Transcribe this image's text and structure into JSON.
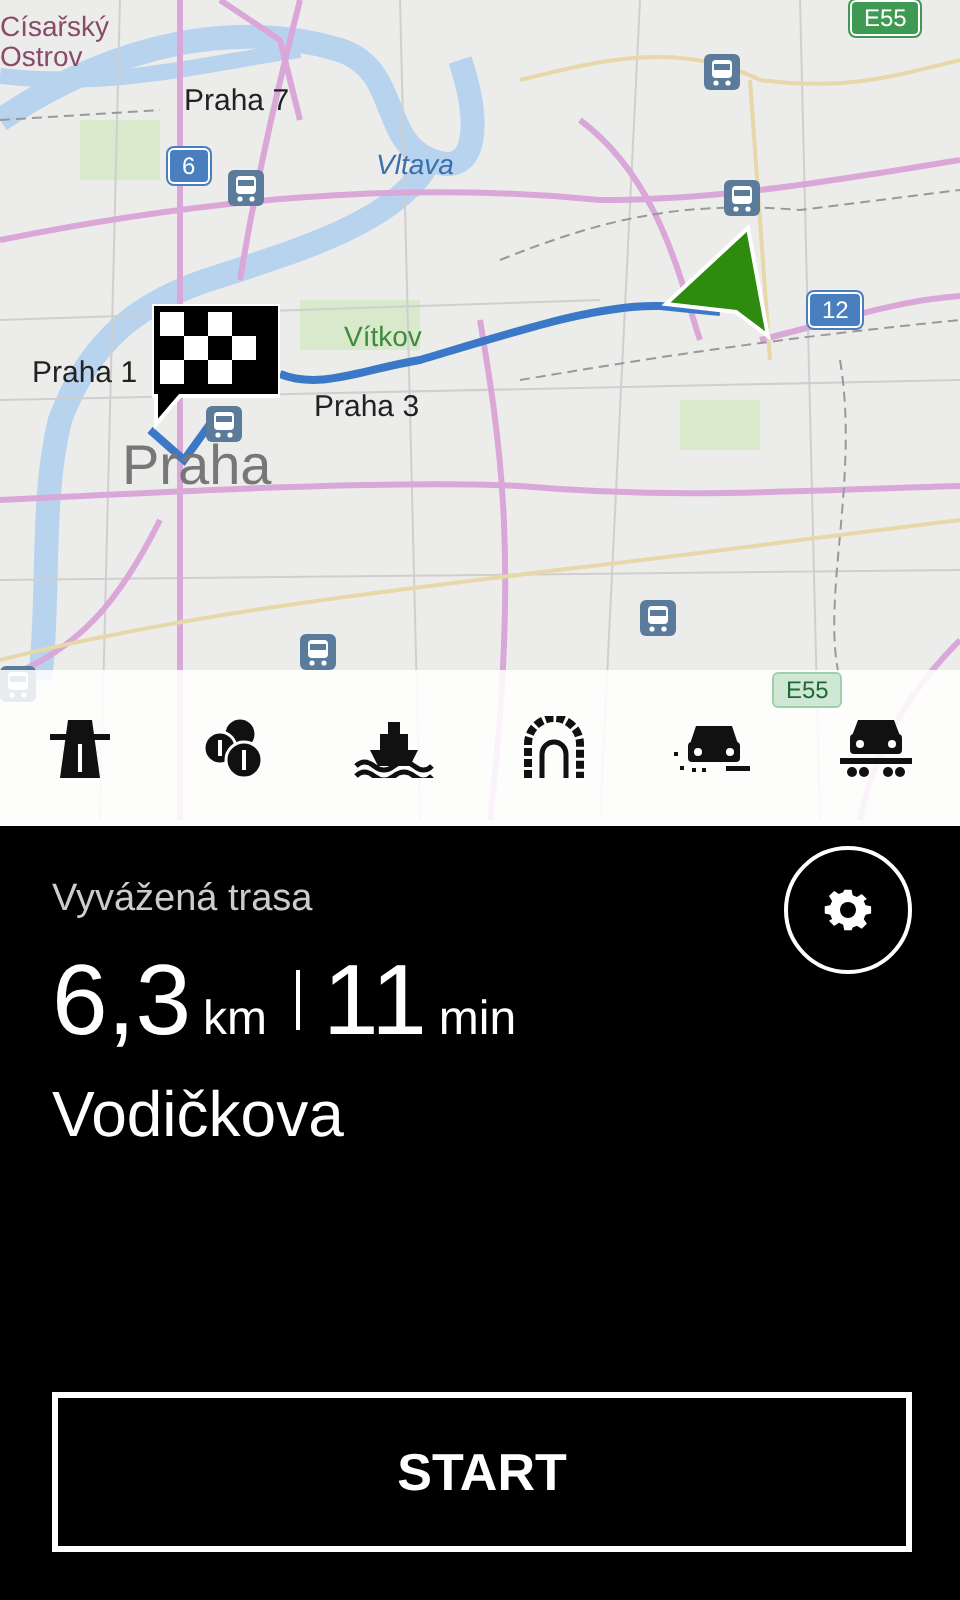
{
  "map": {
    "labels": [
      {
        "text": "Císařský Ostrov",
        "kind": "district"
      },
      {
        "text": "Praha 7",
        "kind": "area"
      },
      {
        "text": "Vltava",
        "kind": "water"
      },
      {
        "text": "Praha 1",
        "kind": "area"
      },
      {
        "text": "Vítkov",
        "kind": "park"
      },
      {
        "text": "Praha 3",
        "kind": "area"
      },
      {
        "text": "Praha",
        "kind": "city"
      }
    ],
    "shields": [
      {
        "text": "6",
        "faded": false
      },
      {
        "text": "12",
        "faded": false
      },
      {
        "text": "E55",
        "faded": false
      },
      {
        "text": "E55",
        "faded": true
      }
    ]
  },
  "route": {
    "type": "Vyvážená trasa",
    "distance": "6,3",
    "distance_unit": "km",
    "duration": "11",
    "duration_unit": "min",
    "street": "Vodičkova"
  },
  "start_button": "START"
}
